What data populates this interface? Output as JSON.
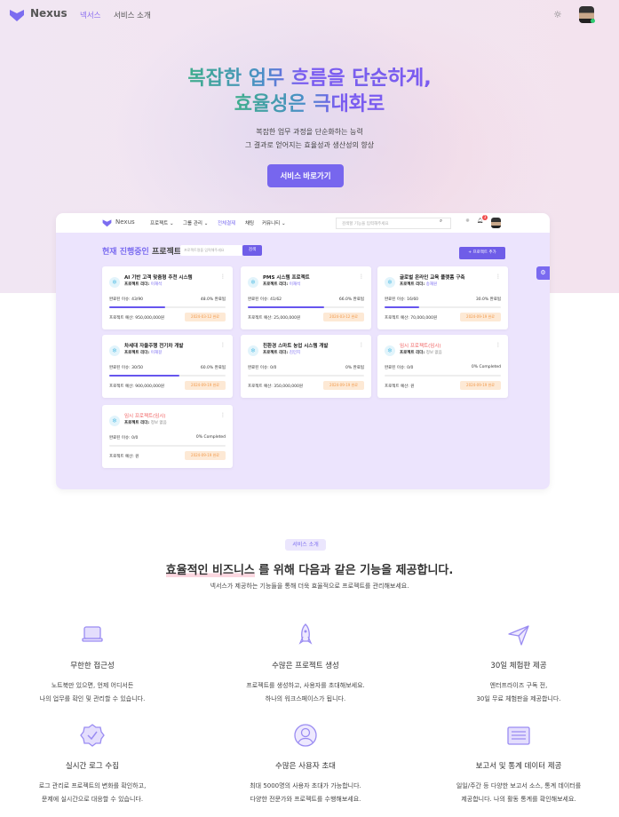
{
  "nav": {
    "brand": "Nexus",
    "links": [
      "넥서스",
      "서비스 소개"
    ]
  },
  "hero": {
    "title_line1_a": "복잡한 업무 흐름을 ",
    "title_line1_b": "단순하게,",
    "title_line2": "효율성은 극대화로",
    "sub1": "복잡한 업무 과정을 단순화하는 능력",
    "sub2": "그 결과로 얻어지는 효율성과 생산성의 향상",
    "cta": "서비스 바로가기"
  },
  "mock": {
    "brand": "Nexus",
    "menu": [
      "프로젝트 ⌄",
      "그룹 관리 ⌄",
      "전체결제",
      "채팅",
      "커뮤니티 ⌄"
    ],
    "search_placeholder": "검색할 기능을 입력해주세요",
    "heading_a": "현재 진행중인",
    "heading_b": " 프로젝트",
    "input_placeholder": "프로젝트명을 입력해주세요",
    "search_btn": "검색",
    "add_btn": "+ 프로젝트 추가",
    "notif": "3",
    "cards": [
      {
        "name": "AI 기반 고객 맞춤형 추천 시스템",
        "leader_label": "프로젝트 리더: ",
        "leader": "이재석",
        "issues": "완료된 이슈: 43/90",
        "percent": "48.0% 완료됨",
        "progress": 48,
        "budget": "프로젝트 예산: 950,000,000원",
        "date": "2024-03-12 완료",
        "temp": false
      },
      {
        "name": "PMS 시스템 프로젝트",
        "leader_label": "프로젝트 리더: ",
        "leader": "이재석",
        "issues": "완료된 이슈: 41/62",
        "percent": "66.0% 완료됨",
        "progress": 66,
        "budget": "프로젝트 예산: 25,000,000원",
        "date": "2024-03-12 완료",
        "temp": false
      },
      {
        "name": "글로벌 온라인 교육 플랫폼 구축",
        "leader_label": "프로젝트 리더: ",
        "leader": "송재원",
        "issues": "완료된 이슈: 16/60",
        "percent": "30.0% 완료됨",
        "progress": 30,
        "budget": "프로젝트 예산: 70,000,000원",
        "date": "2024-09-19 완료",
        "temp": false
      },
      {
        "name": "차세대 자율주행 전기차 개발",
        "leader_label": "프로젝트 리더: ",
        "leader": "이재걸",
        "issues": "완료된 이슈: 30/50",
        "percent": "60.0% 완료됨",
        "progress": 60,
        "budget": "프로젝트 예산: 900,000,000원",
        "date": "2024-09-19 완료",
        "temp": false
      },
      {
        "name": "친환경 스마트 농업 시스템 개발",
        "leader_label": "프로젝트 리더: ",
        "leader": "김민지",
        "issues": "완료된 이슈: 0/0",
        "percent": "0% 완료됨",
        "progress": 0,
        "budget": "프로젝트 예산: 350,000,000원",
        "date": "2024-09-19 완료",
        "temp": false
      },
      {
        "name": "임시 프로젝트(임시)",
        "leader_label": "프로젝트 리더: ",
        "leader": "정보 없음",
        "issues": "완료된 이슈: 0/0",
        "percent": "0% Completed",
        "progress": 0,
        "budget": "프로젝트 예산: 원",
        "date": "2024-09-19 완료",
        "temp": true
      },
      {
        "name": "임시 프로젝트(임시)",
        "leader_label": "프로젝트 리더: ",
        "leader": "정보 없음",
        "issues": "완료된 이슈: 0/0",
        "percent": "0% Completed",
        "progress": 0,
        "budget": "프로젝트 예산: 원",
        "date": "2024-09-19 완료",
        "temp": true
      }
    ]
  },
  "services": {
    "badge": "서비스 소개",
    "title_hl": "효율적인 비즈니스",
    "title_rest": " 를 위해 다음과 같은 기능을 제공합니다.",
    "subtitle": "넥서스가 제공하는 기능들을 통해 더욱 효율적으로 프로젝트를 관리해보세요.",
    "features": [
      {
        "icon": "laptop-icon",
        "title": "무한한 접근성",
        "d1": "노트북만 있으면, 언제 어디서든",
        "d2": "나의 업무를 확인 및 관리할 수 있습니다."
      },
      {
        "icon": "rocket-icon",
        "title": "수많은 프로젝트 생성",
        "d1": "프로젝트를 생성하고, 사용자를 초대해보세요.",
        "d2": "하나의 워크스페이스가 됩니다."
      },
      {
        "icon": "paper-plane-icon",
        "title": "30일 체험판 제공",
        "d1": "엔터프라이즈 구독 전,",
        "d2": "30일 무료 체험판을 제공합니다."
      },
      {
        "icon": "badge-check-icon",
        "title": "실시간 로그 수집",
        "d1": "로그 관리로 프로젝트의 변화를 확인하고,",
        "d2": "문제에 실시간으로 대응할 수 있습니다."
      },
      {
        "icon": "user-circle-icon",
        "title": "수많은 사용자 초대",
        "d1": "최대 5000명의 사용자 초대가 가능합니다.",
        "d2": "다양한 전문가와 프로젝트를 수행해보세요."
      },
      {
        "icon": "report-icon",
        "title": "보고서 및 통계 데이터 제공",
        "d1": "일일/주간 등 다양한 보고서 소스, 통계 데이터를",
        "d2": "제공합니다. 나의 활동 통계를 확인해보세요."
      }
    ]
  },
  "colors": {
    "accent": "#7766ee",
    "teal": "#3fae8c",
    "date_bg": "#fde9d5"
  }
}
